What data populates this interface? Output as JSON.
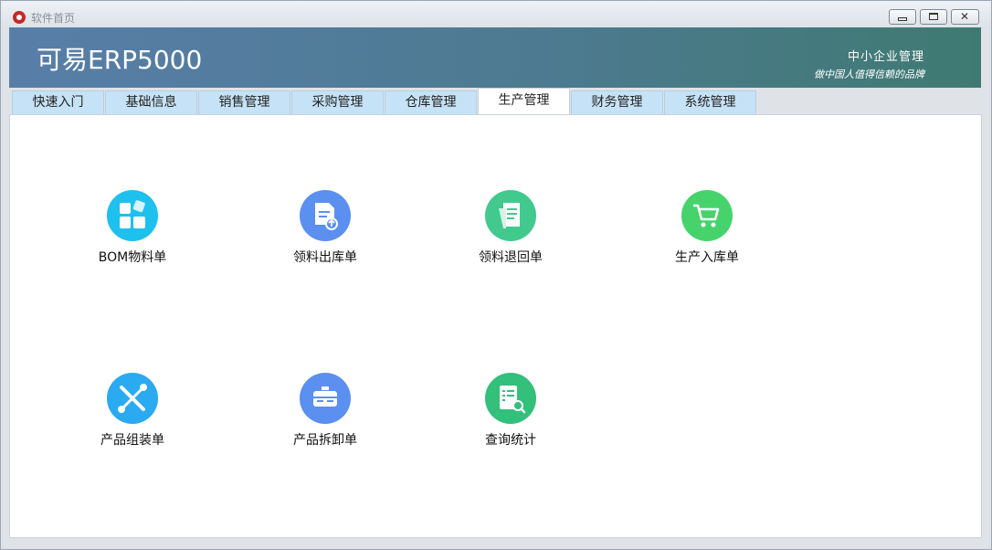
{
  "window": {
    "title": "软件首页"
  },
  "header": {
    "brand": "可易ERP5000",
    "tagline_main": "中小企业管理",
    "tagline_sub": "做中国人值得信赖的品牌"
  },
  "tabs": [
    {
      "label": "快速入门"
    },
    {
      "label": "基础信息"
    },
    {
      "label": "销售管理"
    },
    {
      "label": "采购管理"
    },
    {
      "label": "仓库管理"
    },
    {
      "label": "生产管理",
      "active": true
    },
    {
      "label": "财务管理"
    },
    {
      "label": "系统管理"
    }
  ],
  "modules": [
    {
      "label": "BOM物料单",
      "icon": "bom-grid-icon",
      "color": "#1ec0ee"
    },
    {
      "label": "领料出库单",
      "icon": "document-upload-icon",
      "color": "#5b8ff0"
    },
    {
      "label": "领料退回单",
      "icon": "document-return-icon",
      "color": "#42c98e"
    },
    {
      "label": "生产入库单",
      "icon": "shopping-cart-icon",
      "color": "#46d36c"
    },
    {
      "label": "产品组装单",
      "icon": "wrench-screwdriver-icon",
      "color": "#2aaaf0"
    },
    {
      "label": "产品拆卸单",
      "icon": "toolbox-icon",
      "color": "#5b8ff0"
    },
    {
      "label": "查询统计",
      "icon": "search-list-icon",
      "color": "#32c07a"
    }
  ]
}
